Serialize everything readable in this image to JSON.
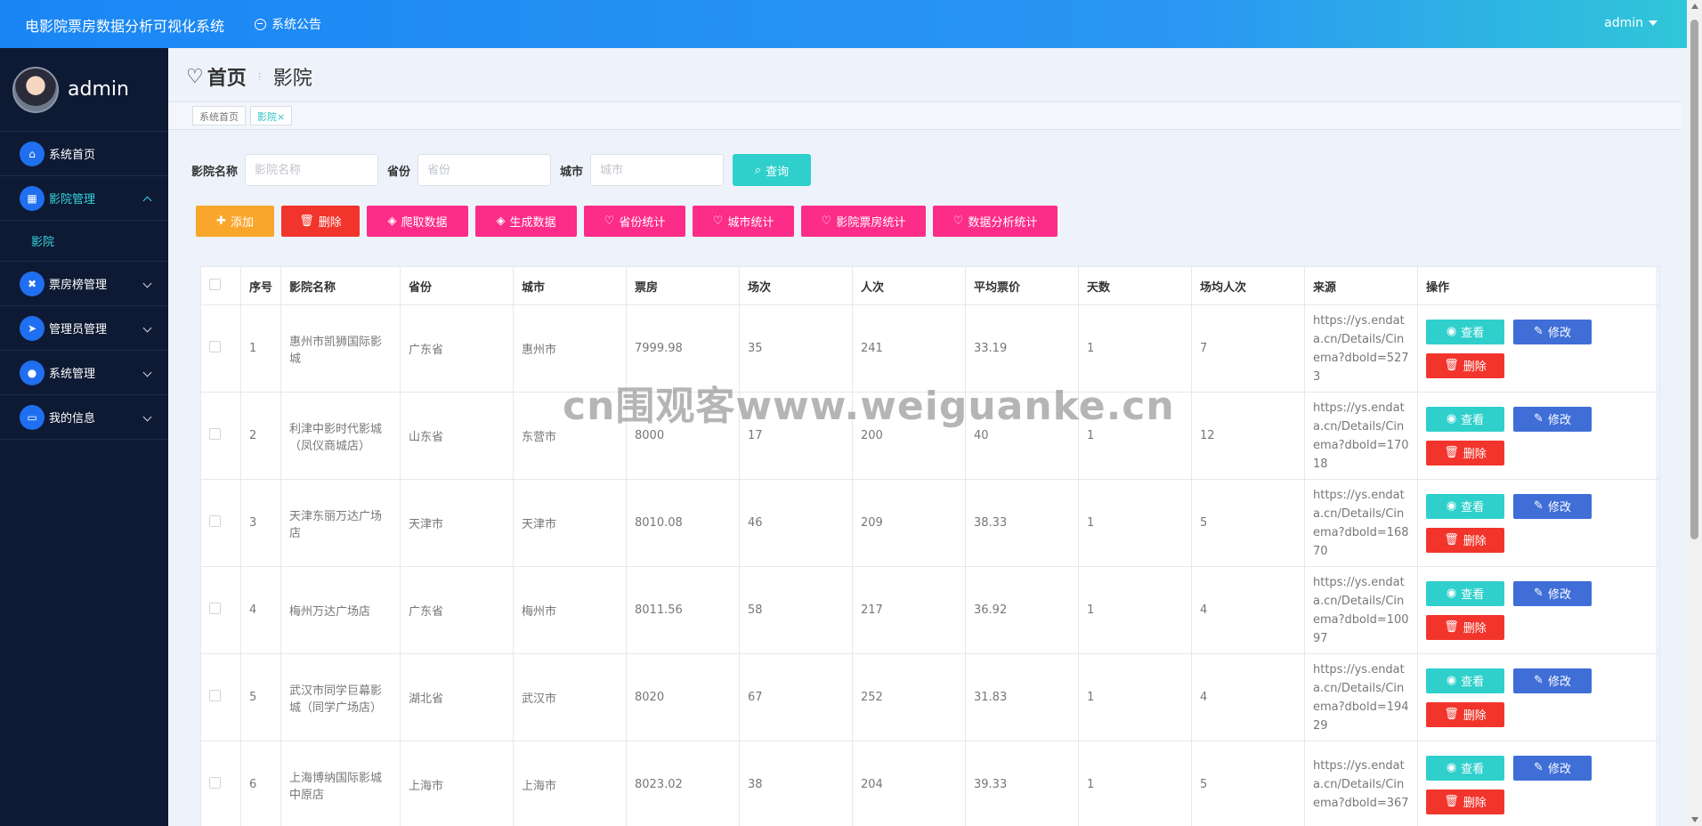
{
  "header": {
    "title": "电影院票房数据分析可视化系统",
    "notice": "系统公告",
    "user": "admin"
  },
  "sidebar": {
    "username": "admin",
    "items": [
      {
        "label": "系统首页",
        "icon": "home-icon"
      },
      {
        "label": "影院管理",
        "icon": "grid-icon",
        "sub": "影院"
      },
      {
        "label": "票房榜管理",
        "icon": "ticket-icon"
      },
      {
        "label": "管理员管理",
        "icon": "send-icon"
      },
      {
        "label": "系统管理",
        "icon": "user-icon"
      },
      {
        "label": "我的信息",
        "icon": "card-icon"
      }
    ]
  },
  "breadcrumb": {
    "home": "首页",
    "current": "影院"
  },
  "tags": {
    "home": "系统首页",
    "current": "影院×"
  },
  "search": {
    "name_label": "影院名称",
    "name_placeholder": "影院名称",
    "province_label": "省份",
    "province_placeholder": "省份",
    "city_label": "城市",
    "city_placeholder": "城市",
    "button": "查询"
  },
  "actions": {
    "add": "添加",
    "delete": "删除",
    "crawl": "爬取数据",
    "generate": "生成数据",
    "province_stats": "省份统计",
    "city_stats": "城市统计",
    "boxoffice_stats": "影院票房统计",
    "analysis_stats": "数据分析统计"
  },
  "table": {
    "headers": [
      "序号",
      "影院名称",
      "省份",
      "城市",
      "票房",
      "场次",
      "人次",
      "平均票价",
      "天数",
      "场均人次",
      "来源",
      "操作"
    ],
    "view_label": "查看",
    "edit_label": "修改",
    "delete_label": "删除",
    "rows": [
      {
        "no": "1",
        "name": "惠州市凯狮国际影城",
        "province": "广东省",
        "city": "惠州市",
        "boxoffice": "7999.98",
        "shows": "35",
        "people": "241",
        "avg": "33.19",
        "days": "1",
        "per_show": "7",
        "source": "https://ys.endata.cn/Details/Cinema?dbold=5273"
      },
      {
        "no": "2",
        "name": "利津中影时代影城（凤仪商城店）",
        "province": "山东省",
        "city": "东营市",
        "boxoffice": "8000",
        "shows": "17",
        "people": "200",
        "avg": "40",
        "days": "1",
        "per_show": "12",
        "source": "https://ys.endata.cn/Details/Cinema?dbold=17018"
      },
      {
        "no": "3",
        "name": "天津东丽万达广场店",
        "province": "天津市",
        "city": "天津市",
        "boxoffice": "8010.08",
        "shows": "46",
        "people": "209",
        "avg": "38.33",
        "days": "1",
        "per_show": "5",
        "source": "https://ys.endata.cn/Details/Cinema?dbold=16870"
      },
      {
        "no": "4",
        "name": "梅州万达广场店",
        "province": "广东省",
        "city": "梅州市",
        "boxoffice": "8011.56",
        "shows": "58",
        "people": "217",
        "avg": "36.92",
        "days": "1",
        "per_show": "4",
        "source": "https://ys.endata.cn/Details/Cinema?dbold=10097"
      },
      {
        "no": "5",
        "name": "武汉市同学巨幕影城（同学广场店）",
        "province": "湖北省",
        "city": "武汉市",
        "boxoffice": "8020",
        "shows": "67",
        "people": "252",
        "avg": "31.83",
        "days": "1",
        "per_show": "4",
        "source": "https://ys.endata.cn/Details/Cinema?dbold=19429"
      },
      {
        "no": "6",
        "name": "上海博纳国际影城中原店",
        "province": "上海市",
        "city": "上海市",
        "boxoffice": "8023.02",
        "shows": "38",
        "people": "204",
        "avg": "39.33",
        "days": "1",
        "per_show": "5",
        "source": "https://ys.endata.cn/Details/Cinema?dbold=367"
      }
    ]
  },
  "watermark": "cn围观客www.weiguanke.cn"
}
